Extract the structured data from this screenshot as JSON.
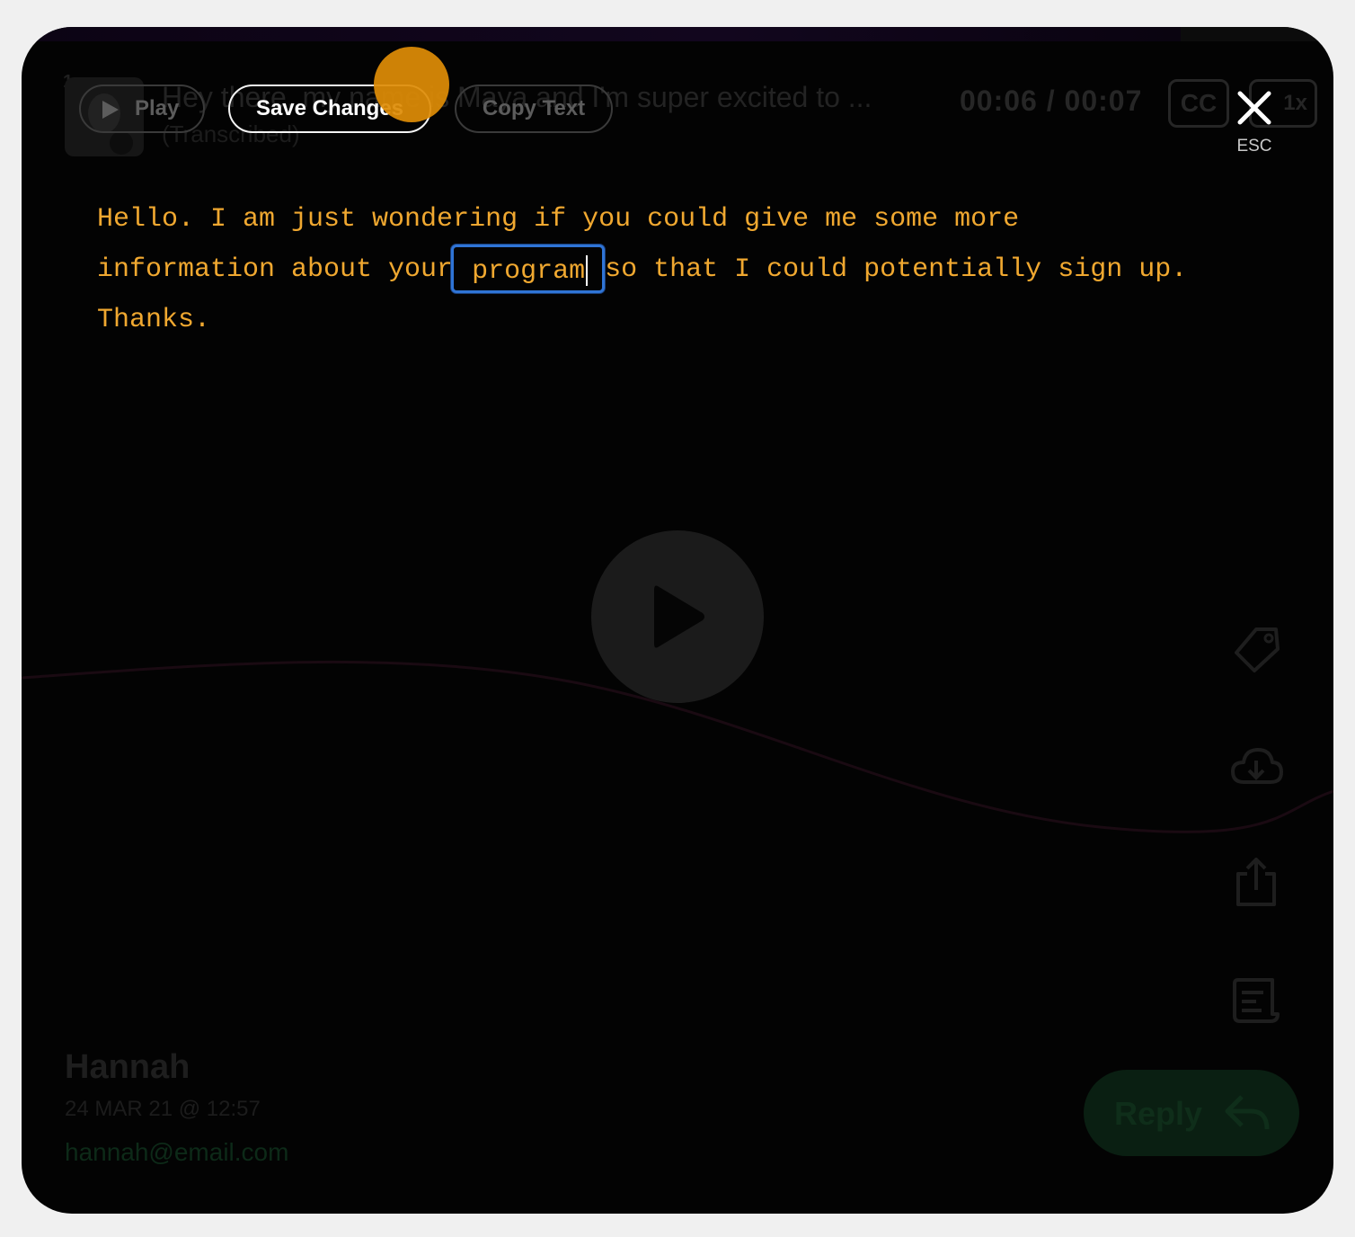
{
  "message": {
    "index": "1",
    "title": "Hey there, my name is Maya and I'm super excited to ...",
    "subtitle": "(Transcribed)",
    "time": "00:06 / 00:07",
    "cc_label": "CC",
    "speed_label": "1x"
  },
  "toolbar": {
    "play_label": "Play",
    "save_label": "Save Changes",
    "copy_label": "Copy Text",
    "close_hint": "ESC"
  },
  "transcript": {
    "line1": "Hello. I am just wondering if you could give me some more",
    "line2_before": "information about your",
    "line2_edit": "program",
    "line2_after": "so that I could potentially sign up.",
    "line3": "Thanks."
  },
  "sender": {
    "name": "Hannah",
    "date": "24 MAR 21 @ 12:57",
    "email": "hannah@email.com"
  },
  "reply": {
    "label": "Reply"
  },
  "colors": {
    "accent": "#f0a830",
    "cursor_highlight": "#de8c06",
    "edit_border": "#2f74d6",
    "reply_bg": "#0a1f12"
  },
  "icons": {
    "tag": "tag-icon",
    "download": "cloud-download-icon",
    "share": "share-icon",
    "transcript": "transcript-icon"
  }
}
